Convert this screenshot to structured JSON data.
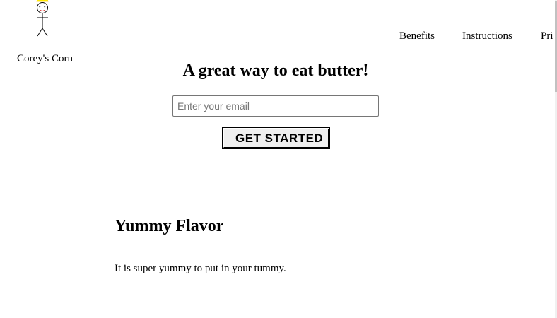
{
  "header": {
    "brand_name": "Corey's Corn",
    "logo_icon": "stick-figure-with-crown-icon",
    "nav": [
      {
        "label": "Benefits"
      },
      {
        "label": "Instructions"
      },
      {
        "label": "Pri"
      }
    ]
  },
  "hero": {
    "headline": "A great way to eat butter!",
    "email_placeholder": "Enter your email",
    "email_value": "",
    "cta_label": "GET STARTED"
  },
  "features": [
    {
      "title": "Yummy Flavor",
      "text": "It is super yummy to put in your tummy."
    }
  ],
  "colors": {
    "crown": "#ffeb00",
    "button_bg": "#efefef"
  }
}
